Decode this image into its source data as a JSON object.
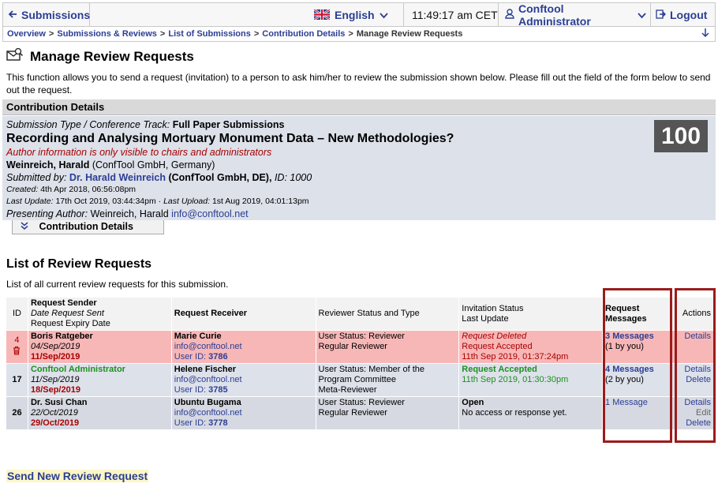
{
  "topbar": {
    "submissions": "Submissions",
    "language": "English",
    "time": "11:49:17 am CET",
    "user": "Conftool Administrator",
    "logout": "Logout"
  },
  "breadcrumb": [
    "Overview",
    "Submissions & Reviews",
    "List of Submissions",
    "Contribution Details",
    "Manage Review Requests"
  ],
  "page": {
    "title": "Manage Review Requests",
    "intro": "This function allows you to send a request (invitation) to a person to ask him/her to review the submission shown below. Please fill out the field of the form below to send out the request."
  },
  "contribution": {
    "header": "Contribution Details",
    "type_label": "Submission Type / Conference Track:",
    "type_value": "Full Paper Submissions",
    "title": "Recording and Analysing Mortuary Monument Data – New Methodologies?",
    "notice": "Author information is only visible to chairs and administrators",
    "author_name": "Weinreich, Harald",
    "author_org": "(ConfTool GmbH, Germany)",
    "submitted_label": "Submitted by:",
    "submitted_name": "Dr. Harald Weinreich",
    "submitted_org": "(ConfTool GmbH, DE),",
    "id_label": "ID: 1000",
    "created_label": "Created:",
    "created_value": "4th Apr 2018, 06:56:08pm",
    "lastupdate_label": "Last Update:",
    "lastupdate_value": "17th Oct 2019, 03:44:34pm",
    "lastupload_label": "· Last Upload:",
    "lastupload_value": "1st Aug 2019, 04:01:13pm",
    "presenting_label": "Presenting Author:",
    "presenting_name": "Weinreich, Harald",
    "presenting_email": "info@conftool.net",
    "score": "100",
    "toggle": "Contribution Details"
  },
  "list": {
    "heading": "List of Review Requests",
    "subtitle": "List of all current review requests for this submission.",
    "headers": {
      "id": "ID",
      "sender": "Request Sender",
      "date_sent": "Date Request Sent",
      "expiry": "Request Expiry Date",
      "receiver": "Request Receiver",
      "status": "Reviewer Status and Type",
      "inv_status": "Invitation Status",
      "last_update": "Last Update",
      "messages": "Request Messages",
      "actions": "Actions"
    },
    "rows": [
      {
        "id": "4",
        "sender": "Boris Ratgeber",
        "sent": "04/Sep/2019",
        "expiry": "11/Sep/2019",
        "receiver": "Marie Curie",
        "email": "info@conftool.net",
        "user_label": "User ID:",
        "user_id": "3786",
        "status1": "User Status: Reviewer",
        "status2": "Regular Reviewer",
        "inv1": "Request Deleted",
        "inv2": "Request Accepted",
        "inv3": "11th Sep 2019, 01:37:24pm",
        "msg": "3 Messages",
        "msg_sub": "(1 by you)",
        "action1": "Details"
      },
      {
        "id": "17",
        "sender": "Conftool Administrator",
        "sent": "11/Sep/2019",
        "expiry": "18/Sep/2019",
        "receiver": "Helene Fischer",
        "email": "info@conftool.net",
        "user_label": "User ID:",
        "user_id": "3785",
        "status1": "User Status: Member of the Program Committee",
        "status2": "Meta-Reviewer",
        "inv1": "Request Accepted",
        "inv2": "11th Sep 2019, 01:30:30pm",
        "msg": "4 Messages",
        "msg_sub": "(2 by you)",
        "action1": "Details",
        "action2": "Delete"
      },
      {
        "id": "26",
        "sender": "Dr. Susi Chan",
        "sent": "22/Oct/2019",
        "expiry": "29/Oct/2019",
        "receiver": "Ubuntu Bugama",
        "email": "info@conftool.net",
        "user_label": "User ID:",
        "user_id": "3778",
        "status1": "User Status: Reviewer",
        "status2": "Regular Reviewer",
        "inv1": "Open",
        "inv2": "No access or response yet.",
        "msg": "1 Message",
        "action1": "Details",
        "action2": "Edit",
        "action3": "Delete"
      }
    ]
  },
  "send_button": "Send New Review Request"
}
